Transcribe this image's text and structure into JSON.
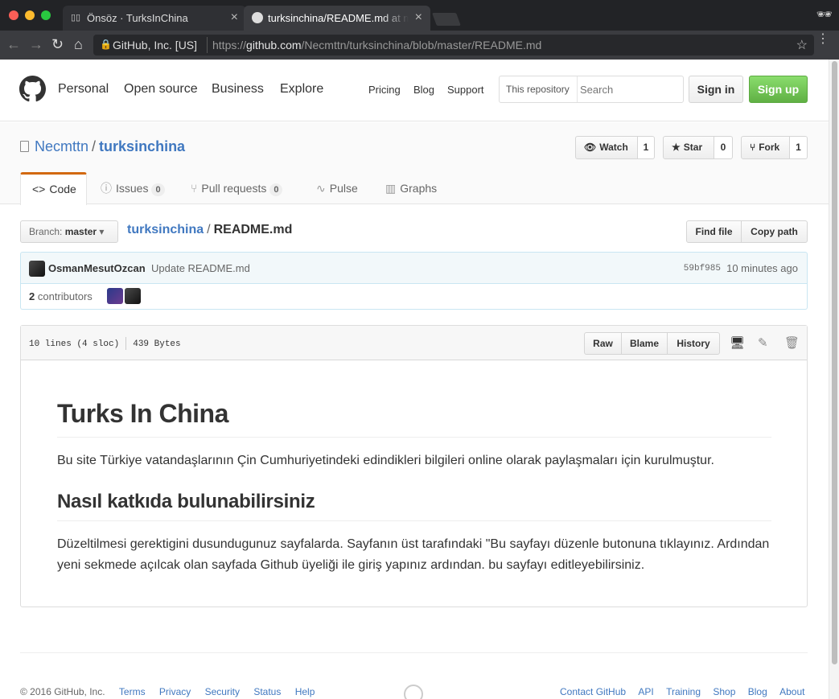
{
  "browser": {
    "tabs": [
      {
        "title": "Önsöz · TurksInChina",
        "favicon": "book-icon",
        "active": false
      },
      {
        "title": "turksinchina/README.md at master",
        "favicon": "github-icon",
        "active": true
      }
    ],
    "address": {
      "ev_label": "GitHub, Inc. [US]",
      "scheme": "https://",
      "host": "github.com",
      "path": "/Necmttn/turksinchina/blob/master/README.md"
    }
  },
  "header": {
    "nav": [
      "Personal",
      "Open source",
      "Business",
      "Explore"
    ],
    "subnav": [
      "Pricing",
      "Blog",
      "Support"
    ],
    "search": {
      "scope": "This repository",
      "placeholder": "Search"
    },
    "sign_in": "Sign in",
    "sign_up": "Sign up"
  },
  "repo": {
    "owner": "Necmttn",
    "name": "turksinchina",
    "watch": {
      "label": "Watch",
      "count": "1"
    },
    "star": {
      "label": "Star",
      "count": "0"
    },
    "fork": {
      "label": "Fork",
      "count": "1"
    },
    "tabs": [
      {
        "label": "Code",
        "icon": "code-icon"
      },
      {
        "label": "Issues",
        "icon": "issue-icon",
        "count": "0"
      },
      {
        "label": "Pull requests",
        "icon": "pull-request-icon",
        "count": "0"
      },
      {
        "label": "Pulse",
        "icon": "pulse-icon"
      },
      {
        "label": "Graphs",
        "icon": "graph-icon"
      }
    ]
  },
  "file_nav": {
    "branch_label": "Branch:",
    "branch": "master",
    "repo_link": "turksinchina",
    "file": "README.md",
    "find_file": "Find file",
    "copy_path": "Copy path"
  },
  "commit": {
    "author": "OsmanMesutOzcan",
    "message": "Update README.md",
    "sha": "59bf985",
    "time": "10 minutes ago",
    "contributors_count": "2",
    "contributors_label": "contributors"
  },
  "file": {
    "lines": "10 lines (4 sloc)",
    "size": "439 Bytes",
    "raw": "Raw",
    "blame": "Blame",
    "history": "History"
  },
  "readme": {
    "h1": "Turks In China",
    "p1": "Bu site Türkiye vatandaşlarının Çin Cumhuriyetindeki edindikleri bilgileri online olarak paylaşmaları için kurulmuştur.",
    "h2": "Nasıl katkıda bulunabilirsiniz",
    "p2": "Düzeltilmesi gerektigini dusundugunuz sayfalarda. Sayfanın üst tarafındaki \"Bu sayfayı düzenle butonuna tıklayınız. Ardından yeni sekmede açılcak olan sayfada Github üyeliği ile giriş yapınız ardından. bu sayfayı editleyebilirsiniz."
  },
  "footer": {
    "copyright": "© 2016 GitHub, Inc.",
    "left_links": [
      "Terms",
      "Privacy",
      "Security",
      "Status",
      "Help"
    ],
    "right_links": [
      "Contact GitHub",
      "API",
      "Training",
      "Shop",
      "Blog",
      "About"
    ]
  }
}
